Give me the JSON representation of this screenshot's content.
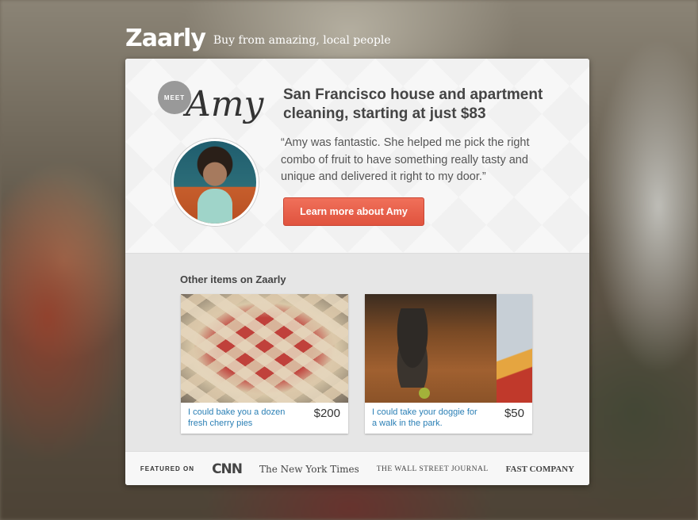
{
  "header": {
    "logo": "Zaarly",
    "tagline": "Buy from amazing, local people"
  },
  "hero": {
    "meet_label": "MEET",
    "seller_name": "Amy",
    "headline": "San Francisco house and apartment cleaning, starting at just $83",
    "quote": "“Amy was fantastic. She helped me pick the right combo of fruit to have something really tasty and unique and delivered it right to my door.”",
    "cta_label": "Learn more about Amy"
  },
  "other_items": {
    "title": "Other items on Zaarly",
    "items": [
      {
        "description": "I could bake you a dozen fresh cherry pies",
        "price": "$200"
      },
      {
        "description": "I could take your doggie for a walk in the park.",
        "price": "$50"
      }
    ]
  },
  "featured": {
    "label": "FEATURED ON",
    "outlets": [
      "CNN",
      "The New York Times",
      "THE WALL STREET JOURNAL",
      "FAST COMPANY"
    ]
  },
  "colors": {
    "cta": "#e65a44",
    "link": "#2a7fb5"
  }
}
